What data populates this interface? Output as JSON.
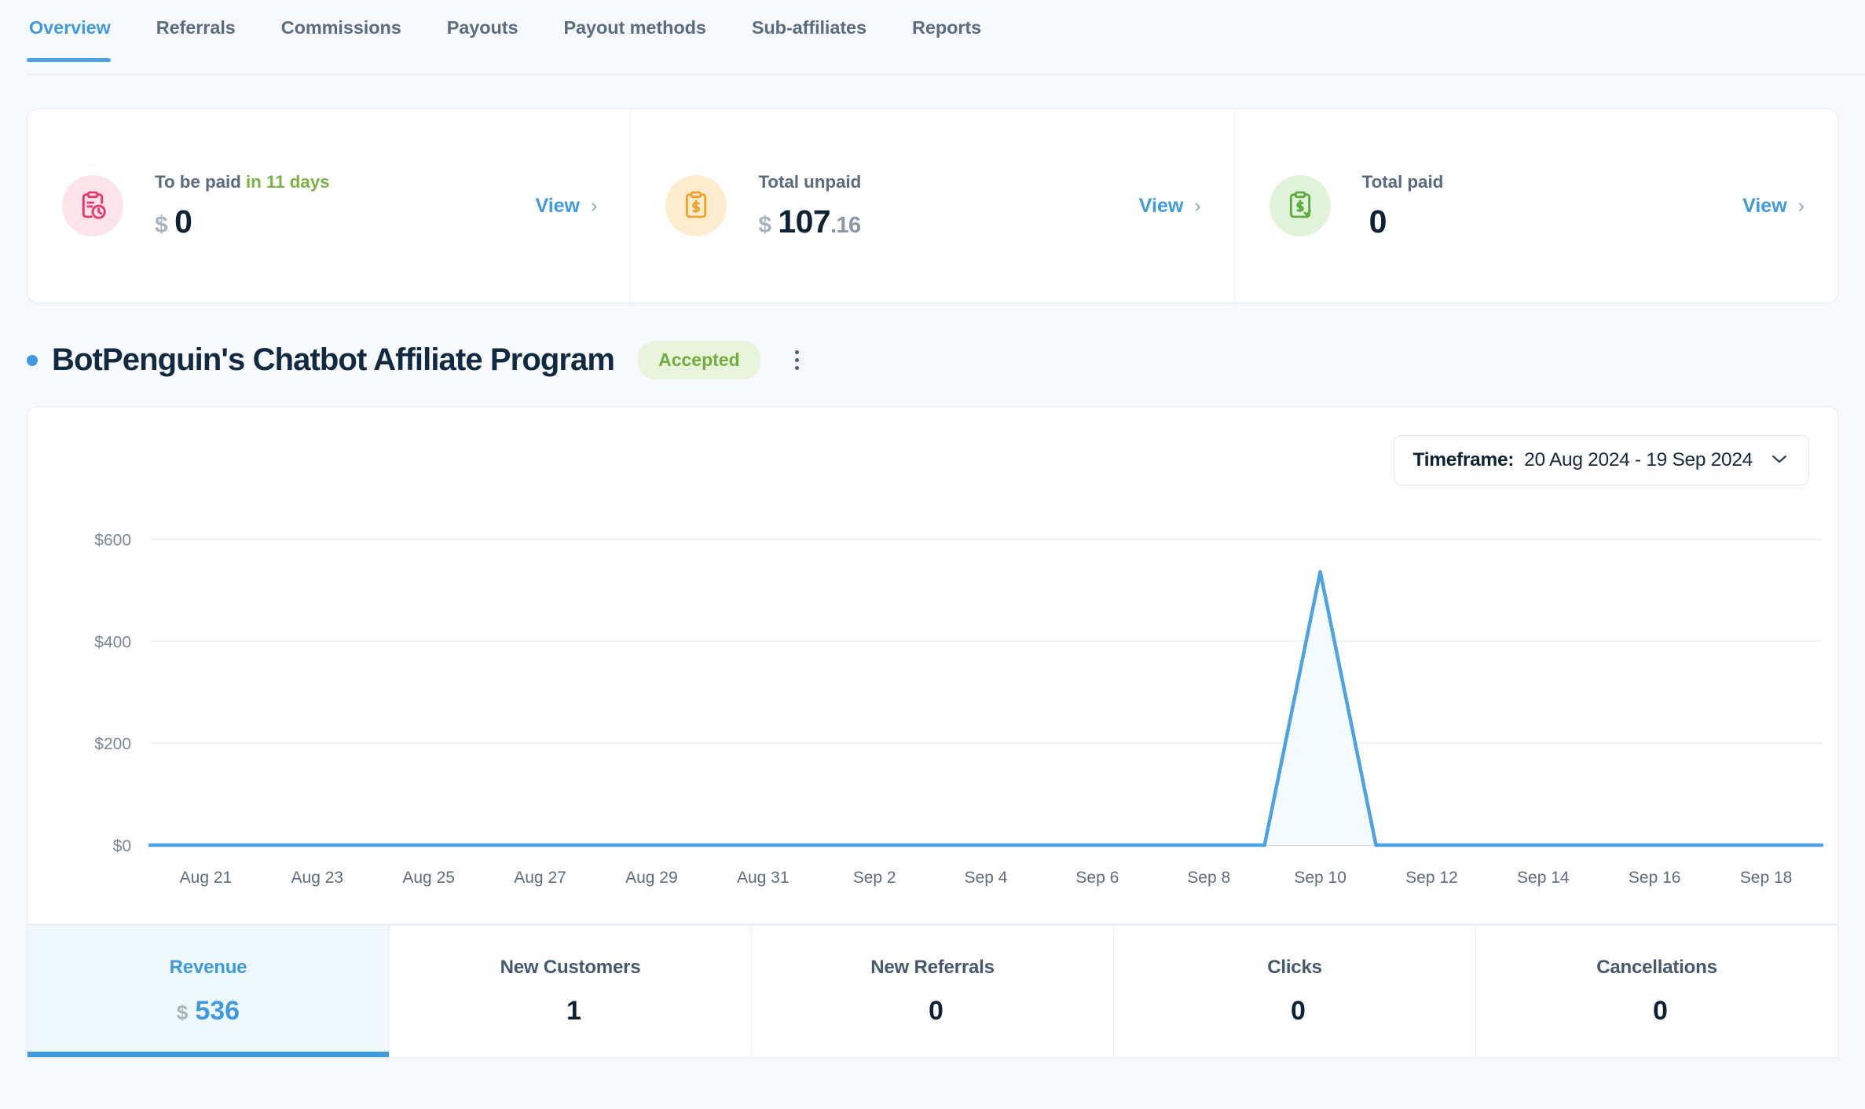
{
  "nav": {
    "tabs": [
      {
        "label": "Overview",
        "active": true
      },
      {
        "label": "Referrals",
        "active": false
      },
      {
        "label": "Commissions",
        "active": false
      },
      {
        "label": "Payouts",
        "active": false
      },
      {
        "label": "Payout methods",
        "active": false
      },
      {
        "label": "Sub-affiliates",
        "active": false
      },
      {
        "label": "Reports",
        "active": false
      }
    ]
  },
  "stats": {
    "cards": [
      {
        "icon": "clipboard-clock-icon",
        "label_prefix": "To be paid ",
        "label_accent": "in 11 days",
        "currency": "$",
        "value": "0",
        "fraction": "",
        "view_label": "View",
        "chevron": "›",
        "icon_color": "#e8356d",
        "icon_bg": "#fde3ea"
      },
      {
        "icon": "clipboard-dollar-icon",
        "label_prefix": "Total unpaid",
        "label_accent": "",
        "currency": "$",
        "value": "107",
        "fraction": ".16",
        "view_label": "View",
        "chevron": "›",
        "icon_color": "#f0a22e",
        "icon_bg": "#fdeccd"
      },
      {
        "icon": "clipboard-check-icon",
        "label_prefix": "Total paid",
        "label_accent": "",
        "currency": "",
        "value": "0",
        "fraction": "",
        "view_label": "View",
        "chevron": "›",
        "icon_color": "#5aab3d",
        "icon_bg": "#e2f3dc"
      }
    ]
  },
  "program": {
    "title": "BotPenguin's Chatbot Affiliate Program",
    "status_badge": "Accepted",
    "bullet_color": "#3f9ae0",
    "menu_icon": "kebab-menu-icon"
  },
  "timeframe": {
    "label": "Timeframe:",
    "value": "20 Aug 2024 - 19 Sep 2024",
    "chevron": "⌄"
  },
  "chart_data": {
    "type": "line",
    "title": "",
    "xlabel": "",
    "ylabel": "",
    "ylim": [
      0,
      650
    ],
    "yticks": [
      0,
      200,
      400,
      600
    ],
    "ytick_labels": [
      "$0",
      "$200",
      "$400",
      "$600"
    ],
    "grid": true,
    "legend": "none",
    "line_color": "#4da2e3",
    "fill_color": "#f4faff",
    "x": [
      "Aug 20",
      "Aug 21",
      "Aug 22",
      "Aug 23",
      "Aug 24",
      "Aug 25",
      "Aug 26",
      "Aug 27",
      "Aug 28",
      "Aug 29",
      "Aug 30",
      "Aug 31",
      "Sep 1",
      "Sep 2",
      "Sep 3",
      "Sep 4",
      "Sep 5",
      "Sep 6",
      "Sep 7",
      "Sep 8",
      "Sep 9",
      "Sep 10",
      "Sep 11",
      "Sep 12",
      "Sep 13",
      "Sep 14",
      "Sep 15",
      "Sep 16",
      "Sep 17",
      "Sep 18",
      "Sep 19"
    ],
    "xtick_labels": [
      "Aug 21",
      "Aug 23",
      "Aug 25",
      "Aug 27",
      "Aug 29",
      "Aug 31",
      "Sep 2",
      "Sep 4",
      "Sep 6",
      "Sep 8",
      "Sep 10",
      "Sep 12",
      "Sep 14",
      "Sep 16",
      "Sep 18"
    ],
    "series": [
      {
        "name": "Revenue",
        "values": [
          0,
          0,
          0,
          0,
          0,
          0,
          0,
          0,
          0,
          0,
          0,
          0,
          0,
          0,
          0,
          0,
          0,
          0,
          0,
          0,
          0,
          536,
          0,
          0,
          0,
          0,
          0,
          0,
          0,
          0,
          0
        ]
      }
    ]
  },
  "metrics": {
    "items": [
      {
        "label": "Revenue",
        "currency": "$",
        "value": "536",
        "active": true
      },
      {
        "label": "New Customers",
        "currency": "",
        "value": "1",
        "active": false
      },
      {
        "label": "New Referrals",
        "currency": "",
        "value": "0",
        "active": false
      },
      {
        "label": "Clicks",
        "currency": "",
        "value": "0",
        "active": false
      },
      {
        "label": "Cancellations",
        "currency": "",
        "value": "0",
        "active": false
      }
    ]
  }
}
